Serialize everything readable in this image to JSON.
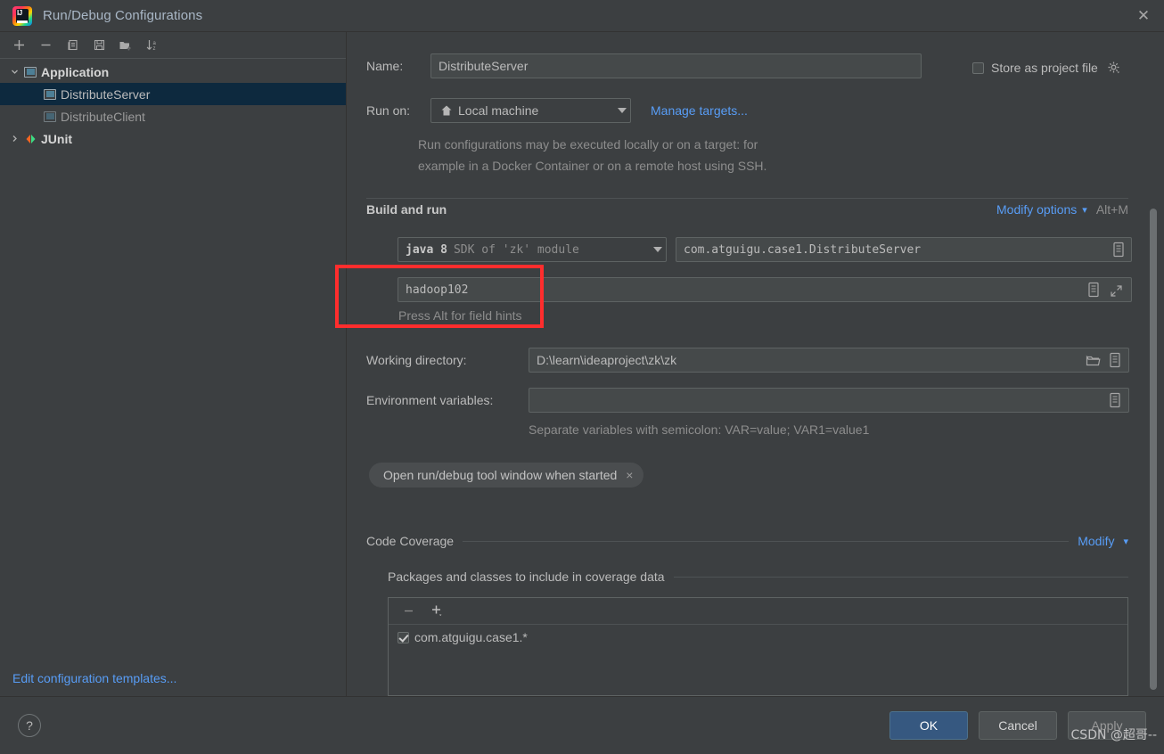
{
  "window": {
    "title": "Run/Debug Configurations",
    "app_icon": "intellij-idea-logo",
    "close_label": "✕"
  },
  "sidebar": {
    "toolbar": [
      {
        "name": "add",
        "glyph": "+"
      },
      {
        "name": "remove",
        "glyph": "−"
      },
      {
        "name": "copy",
        "glyph": "copy-icon"
      },
      {
        "name": "save",
        "glyph": "save-icon"
      },
      {
        "name": "move-to-folder",
        "glyph": "folder-add-icon"
      },
      {
        "name": "sort-alphabetically",
        "glyph": "sort-az-icon"
      }
    ],
    "tree": [
      {
        "label": "Application",
        "type": "group",
        "expanded": true,
        "icon": "application-icon"
      },
      {
        "label": "DistributeServer",
        "type": "child",
        "selected": true,
        "icon": "application-icon"
      },
      {
        "label": "DistributeClient",
        "type": "child",
        "selected": false,
        "icon": "application-icon"
      },
      {
        "label": "JUnit",
        "type": "group",
        "expanded": false,
        "icon": "junit-icon"
      }
    ],
    "edit_templates_link": "Edit configuration templates..."
  },
  "form": {
    "name_label": "Name:",
    "name_value": "DistributeServer",
    "store_as_project_file_label": "Store as project file",
    "store_as_project_file_checked": false,
    "store_gear_icon": "gear-icon",
    "run_on_label": "Run on:",
    "run_on_value": "Local machine",
    "run_on_icon": "home-icon",
    "manage_targets_link": "Manage targets...",
    "run_on_hint_line1": "Run configurations may be executed locally or on a target: for",
    "run_on_hint_line2": "example in a Docker Container or on a remote host using SSH.",
    "build_and_run_title": "Build and run",
    "modify_options_link": "Modify options",
    "modify_options_shortcut": "Alt+M",
    "sdk_value_bold": "java 8",
    "sdk_value_rest": "SDK of 'zk' module",
    "main_class_value": "com.atguigu.case1.DistributeServer",
    "program_args_value": "hadoop102",
    "field_hint": "Press Alt for field hints",
    "working_directory_label": "Working directory:",
    "working_directory_value": "D:\\learn\\ideaproject\\zk\\zk",
    "environment_variables_label": "Environment variables:",
    "environment_variables_value": "",
    "environment_variables_hint": "Separate variables with semicolon: VAR=value; VAR1=value1",
    "open_tool_window_chip": "Open run/debug tool window when started",
    "chip_close_glyph": "×",
    "code_coverage_title": "Code Coverage",
    "code_coverage_modify_link": "Modify",
    "packages_title": "Packages and classes to include in coverage data",
    "coverage_toolbar": [
      {
        "name": "remove-package",
        "glyph": "−"
      },
      {
        "name": "add-package",
        "glyph": "+"
      }
    ],
    "coverage_items": [
      {
        "label": "com.atguigu.case1.*",
        "checked": true
      }
    ]
  },
  "footer": {
    "help_glyph": "?",
    "ok_label": "OK",
    "cancel_label": "Cancel",
    "apply_label": "Apply"
  },
  "annotation": {
    "watermark": "CSDN @超哥--"
  },
  "colors": {
    "background": "#3c3f41",
    "accent_link": "#589df6",
    "selection": "#0d293e",
    "primary_button": "#365880",
    "annotation_red": "#ff2d2d"
  }
}
